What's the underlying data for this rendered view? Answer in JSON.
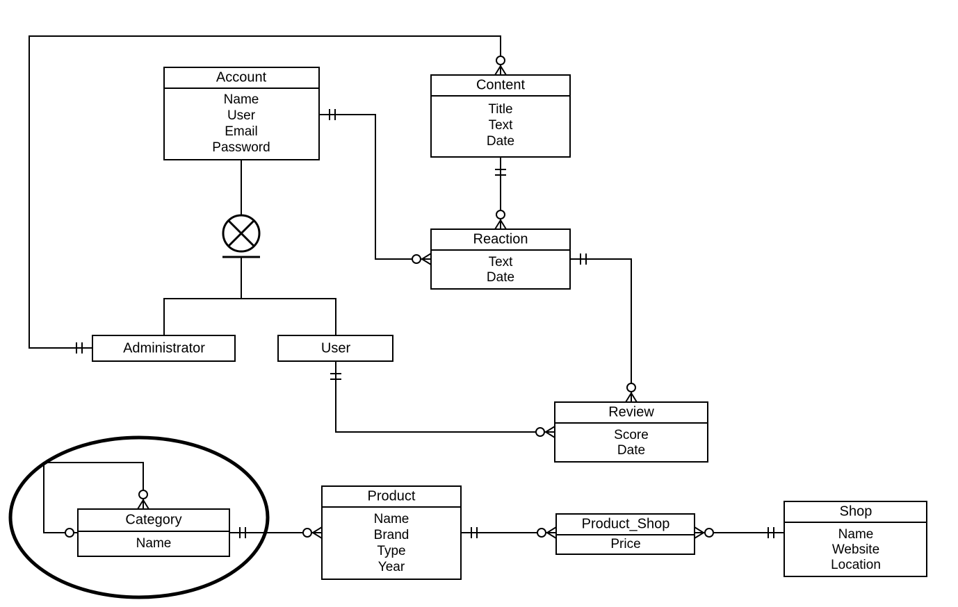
{
  "entities": {
    "account": {
      "title": "Account",
      "attrs": [
        "Name",
        "User",
        "Email",
        "Password"
      ]
    },
    "content": {
      "title": "Content",
      "attrs": [
        "Title",
        "Text",
        "Date"
      ]
    },
    "reaction": {
      "title": "Reaction",
      "attrs": [
        "Text",
        "Date"
      ]
    },
    "review": {
      "title": "Review",
      "attrs": [
        "Score",
        "Date"
      ]
    },
    "administrator": {
      "title": "Administrator",
      "attrs": []
    },
    "user": {
      "title": "User",
      "attrs": []
    },
    "category": {
      "title": "Category",
      "attrs": [
        "Name"
      ]
    },
    "product": {
      "title": "Product",
      "attrs": [
        "Name",
        "Brand",
        "Type",
        "Year"
      ]
    },
    "product_shop": {
      "title": "Product_Shop",
      "attrs": [
        "Price"
      ]
    },
    "shop": {
      "title": "Shop",
      "attrs": [
        "Name",
        "Website",
        "Location"
      ]
    }
  }
}
